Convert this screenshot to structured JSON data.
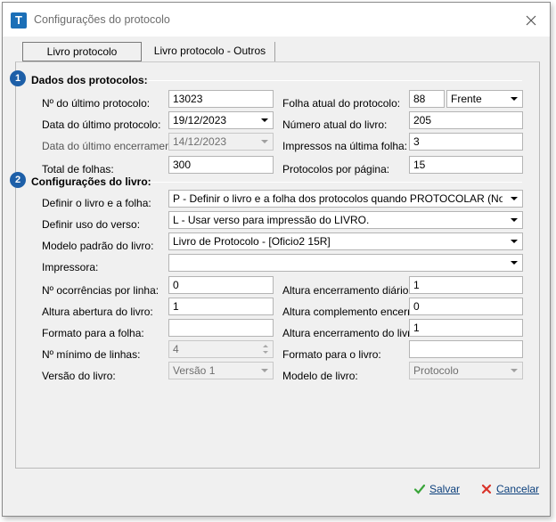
{
  "window": {
    "title": "Configurações do protocolo",
    "app_icon_letter": "T"
  },
  "tabs": [
    {
      "label": "Livro protocolo"
    },
    {
      "label": "Livro protocolo - Outros"
    }
  ],
  "section1": {
    "number": "1",
    "title": "Dados dos protocolos:",
    "ultimo_protocolo_label": "Nº do último protocolo:",
    "ultimo_protocolo_value": "13023",
    "data_ultimo_protocolo_label": "Data do último protocolo:",
    "data_ultimo_protocolo_value": "19/12/2023",
    "data_ultimo_encerramento_label": "Data do último encerramento:",
    "data_ultimo_encerramento_value": "14/12/2023",
    "total_folhas_label": "Total de folhas:",
    "total_folhas_value": "300",
    "folha_atual_label": "Folha atual do protocolo:",
    "folha_atual_value": "88",
    "folha_lado_value": "Frente",
    "numero_livro_label": "Número atual do livro:",
    "numero_livro_value": "205",
    "impressos_label": "Impressos na última folha:",
    "impressos_value": "3",
    "protocolos_pagina_label": "Protocolos por página:",
    "protocolos_pagina_value": "15"
  },
  "section2": {
    "number": "2",
    "title": "Configurações do livro:",
    "definir_livro_label": "Definir o livro e a folha:",
    "definir_livro_value": "P - Definir o livro e a folha dos protocolos quando PROTOCOLAR (Nota de entr",
    "definir_verso_label": "Definir uso do verso:",
    "definir_verso_value": "L - Usar verso para impressão do LIVRO.",
    "modelo_padrao_label": "Modelo padrão do livro:",
    "modelo_padrao_value": "Livro de Protocolo - [Oficio2 15R]",
    "impressora_label": "Impressora:",
    "impressora_value": "",
    "ocorrencias_label": "Nº ocorrências por linha:",
    "ocorrencias_value": "0",
    "altura_abertura_label": "Altura abertura do livro:",
    "altura_abertura_value": "1",
    "formato_folha_label": "Formato para a folha:",
    "formato_folha_value": "",
    "minimo_linhas_label": "Nº mínimo de linhas:",
    "minimo_linhas_value": "4",
    "versao_label": "Versão do livro:",
    "versao_value": "Versão 1",
    "altura_encerramento_diario_label": "Altura encerramento diário:",
    "altura_encerramento_diario_value": "1",
    "altura_complemento_label": "Altura complemento encerr.:",
    "altura_complemento_value": "0",
    "altura_encerramento_livro_label": "Altura encerramento do livro:",
    "altura_encerramento_livro_value": "1",
    "formato_livro_label": "Formato para o livro:",
    "formato_livro_value": "",
    "modelo_livro_label": "Modelo de livro:",
    "modelo_livro_value": "Protocolo"
  },
  "footer": {
    "save_label": "Salvar",
    "cancel_label": "Cancelar"
  },
  "colors": {
    "accent": "#1d5fa8",
    "save_icon": "#3aa53a",
    "cancel_icon": "#d9342b"
  }
}
